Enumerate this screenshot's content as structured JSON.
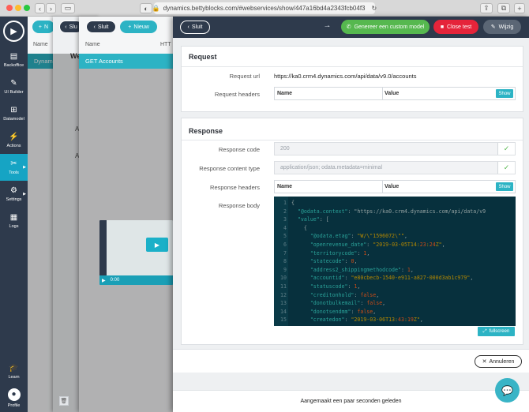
{
  "browser": {
    "url": "dynamics.bettyblocks.com/#webservices/show/447a16bd4a2343fcb04f3"
  },
  "sidebar": {
    "items": [
      {
        "label": "Backoffice",
        "icon": "backoffice-icon"
      },
      {
        "label": "UI Builder",
        "icon": "ui-builder-icon"
      },
      {
        "label": "Datamodel",
        "icon": "datamodel-icon"
      },
      {
        "label": "Actions",
        "icon": "actions-icon"
      },
      {
        "label": "Tools",
        "icon": "tools-icon"
      },
      {
        "label": "Settings",
        "icon": "settings-icon"
      },
      {
        "label": "Logs",
        "icon": "logs-icon"
      },
      {
        "label": "Learn",
        "icon": "learn-icon"
      },
      {
        "label": "Profile",
        "icon": "profile-icon"
      }
    ]
  },
  "background": {
    "panel1_button": "N",
    "panel1_col": "Name",
    "panel1_row": "Dynam",
    "panel2_button": "Slu",
    "panel2_title": "We",
    "panel2_letter1": "A",
    "panel2_letter2": "A",
    "panel3_close": "Sluit",
    "panel3_new": "Nieuw",
    "panel3_col1": "Name",
    "panel3_col2": "HTT",
    "panel3_row": "GET Accounts"
  },
  "toolbar": {
    "close_label": "Sluit",
    "generate_label": "Genereer een custom model",
    "close_test_label": "Close test",
    "edit_label": "Wijzig"
  },
  "request": {
    "title": "Request",
    "url_label": "Request url",
    "url_value": "https://ka0.crm4.dynamics.com/api/data/v9.0/accounts",
    "headers_label": "Request headers",
    "col_name": "Name",
    "col_value": "Value",
    "show_label": "Show"
  },
  "response": {
    "title": "Response",
    "code_label": "Response code",
    "code_value": "200",
    "content_type_label": "Response content type",
    "content_type_value": "application/json; odata.metadata=minimal",
    "headers_label": "Response headers",
    "col_name": "Name",
    "col_value": "Value",
    "show_label": "Show",
    "body_label": "Response body",
    "fullscreen_label": "fullscreen"
  },
  "code_lines": [
    "{",
    "  \"@odata.context\": \"https://ka0.crm4.dynamics.com/api/data/v9",
    "  \"value\": [",
    "    {",
    "      \"@odata.etag\": \"W/\\\"1596072\\\"\",",
    "      \"openrevenue_date\": \"2019-03-05T14:23:24Z\",",
    "      \"territorycode\": 1,",
    "      \"statecode\": 0,",
    "      \"address2_shippingmethodcode\": 1,",
    "      \"accountid\": \"e80cbecb-1540-e911-a827-000d3ab1c979\",",
    "      \"statuscode\": 1,",
    "      \"creditonhold\": false,",
    "      \"donotbulkemail\": false,",
    "      \"donotsendmm\": false,",
    "      \"createdon\": \"2019-03-06T13:43:19Z\","
  ],
  "actions": {
    "cancel_label": "Annuleren"
  },
  "footer": {
    "status_text": "Aangemaakt een paar seconden geleden"
  },
  "video": {
    "time": "0:00"
  }
}
